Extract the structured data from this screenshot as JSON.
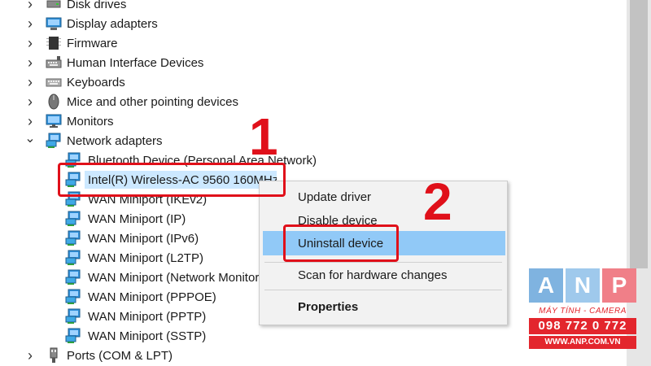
{
  "tree": {
    "items": [
      {
        "label": "Disk drives",
        "icon": "disk-drive-icon",
        "level": 0,
        "expanded": false
      },
      {
        "label": "Display adapters",
        "icon": "display-adapter-icon",
        "level": 0,
        "expanded": false
      },
      {
        "label": "Firmware",
        "icon": "firmware-chip-icon",
        "level": 0,
        "expanded": false
      },
      {
        "label": "Human Interface Devices",
        "icon": "hid-icon",
        "level": 0,
        "expanded": false
      },
      {
        "label": "Keyboards",
        "icon": "keyboard-icon",
        "level": 0,
        "expanded": false
      },
      {
        "label": "Mice and other pointing devices",
        "icon": "mouse-icon",
        "level": 0,
        "expanded": false
      },
      {
        "label": "Monitors",
        "icon": "monitor-icon",
        "level": 0,
        "expanded": false
      },
      {
        "label": "Network adapters",
        "icon": "network-adapter-icon",
        "level": 0,
        "expanded": true
      },
      {
        "label": "Bluetooth Device (Personal Area Network)",
        "icon": "network-adapter-icon",
        "level": 1
      },
      {
        "label": "Intel(R) Wireless-AC 9560 160MHz",
        "icon": "network-adapter-icon",
        "level": 1,
        "selected": true
      },
      {
        "label": "WAN Miniport (IKEv2)",
        "icon": "network-adapter-icon",
        "level": 1
      },
      {
        "label": "WAN Miniport (IP)",
        "icon": "network-adapter-icon",
        "level": 1
      },
      {
        "label": "WAN Miniport (IPv6)",
        "icon": "network-adapter-icon",
        "level": 1
      },
      {
        "label": "WAN Miniport (L2TP)",
        "icon": "network-adapter-icon",
        "level": 1
      },
      {
        "label": "WAN Miniport (Network Monitor)",
        "icon": "network-adapter-icon",
        "level": 1
      },
      {
        "label": "WAN Miniport (PPPOE)",
        "icon": "network-adapter-icon",
        "level": 1
      },
      {
        "label": "WAN Miniport (PPTP)",
        "icon": "network-adapter-icon",
        "level": 1
      },
      {
        "label": "WAN Miniport (SSTP)",
        "icon": "network-adapter-icon",
        "level": 1
      },
      {
        "label": "Ports (COM & LPT)",
        "icon": "port-icon",
        "level": 0,
        "expanded": false
      }
    ]
  },
  "context_menu": {
    "items": [
      {
        "label": "Update driver"
      },
      {
        "label": "Disable device"
      },
      {
        "label": "Uninstall device",
        "highlighted": true
      },
      {
        "label": "Scan for hardware changes"
      },
      {
        "label": "Properties",
        "bold": true
      }
    ]
  },
  "annotations": {
    "step1": "1",
    "step2": "2",
    "color": "#e0101a"
  },
  "watermark": {
    "letters": [
      "A",
      "N",
      "P"
    ],
    "tile_colors": [
      "#7fb3e0",
      "#9fc9ec",
      "#f07f88"
    ],
    "tagline": "MÁY TÍNH - CAMERA",
    "phone": "098 772 0 772",
    "website": "WWW.ANP.COM.VN",
    "brand_color": "#e3262d"
  },
  "colors": {
    "selection": "#cce8ff",
    "menu_highlight": "#91c9f7",
    "menu_bg": "#f2f2f2"
  }
}
